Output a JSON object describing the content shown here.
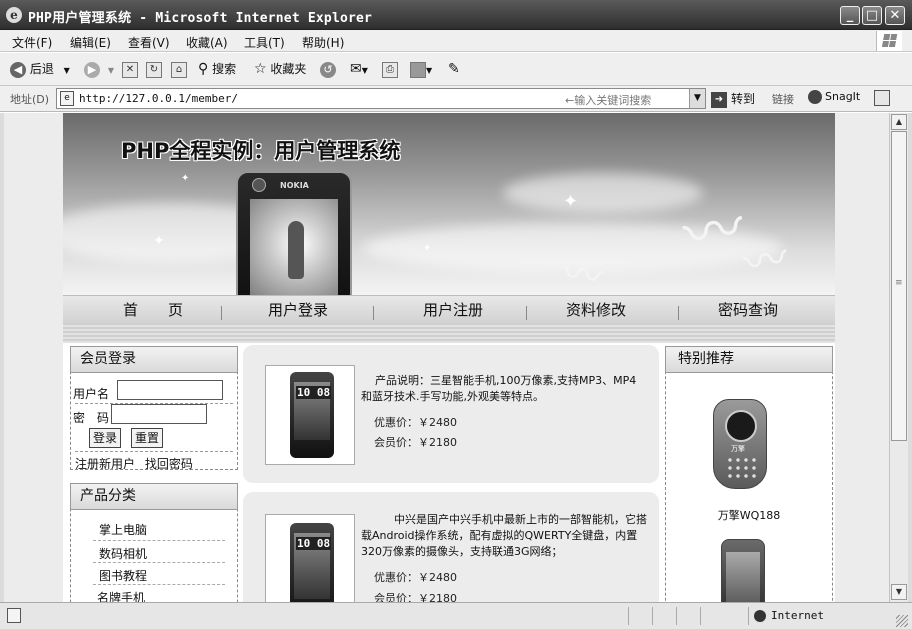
{
  "window": {
    "title": "PHP用户管理系统 - Microsoft Internet Explorer",
    "minimize": "_",
    "maximize": "□",
    "close": "✕"
  },
  "menu": [
    "文件(F)",
    "编辑(E)",
    "查看(V)",
    "收藏(A)",
    "工具(T)",
    "帮助(H)"
  ],
  "toolbar": {
    "back": "后退",
    "search": "搜索",
    "favorites": "收藏夹"
  },
  "address": {
    "label": "地址(D)",
    "url": "http://127.0.0.1/member/",
    "keyword_placeholder": "←输入关键词搜索",
    "go": "转到",
    "links": "链接",
    "snagit": "SnagIt"
  },
  "banner": {
    "title": "PHP全程实例：用户管理系统",
    "phone_brand": "NOKIA"
  },
  "nav": [
    "首　　页",
    "用户登录",
    "用户注册",
    "资料修改",
    "密码查询"
  ],
  "login": {
    "title": "会员登录",
    "username_label": "用户名",
    "password_label": "密　码",
    "login_button": "登录",
    "reset_button": "重置",
    "register_link": "注册新用户",
    "forgot_link": "找回密码"
  },
  "categories": {
    "title": "产品分类",
    "items": [
      "掌上电脑",
      "数码相机",
      "图书教程",
      "名牌手机"
    ]
  },
  "products": [
    {
      "screen_time": "10 08",
      "description": "产品说明：三星智能手机,100万像素,支持MP3、MP4和蓝牙技术.手写功能,外观美等特点。",
      "sale_price": "优惠价：￥2480",
      "member_price": "会员价：￥2180"
    },
    {
      "screen_time": "10 08",
      "description": "中兴是国产中兴手机中最新上市的一部智能机，它搭载Android操作系统，配有虚拟的QWERTY全键盘，内置320万像素的摄像头，支持联通3G网络；",
      "sale_price": "优惠价：￥2480",
      "member_price": "会员价：￥2180"
    }
  ],
  "recommend": {
    "title": "特别推荐",
    "items": [
      {
        "name": "万擎WQ188",
        "brand": "万擎"
      }
    ]
  },
  "status": {
    "zone": "Internet"
  }
}
